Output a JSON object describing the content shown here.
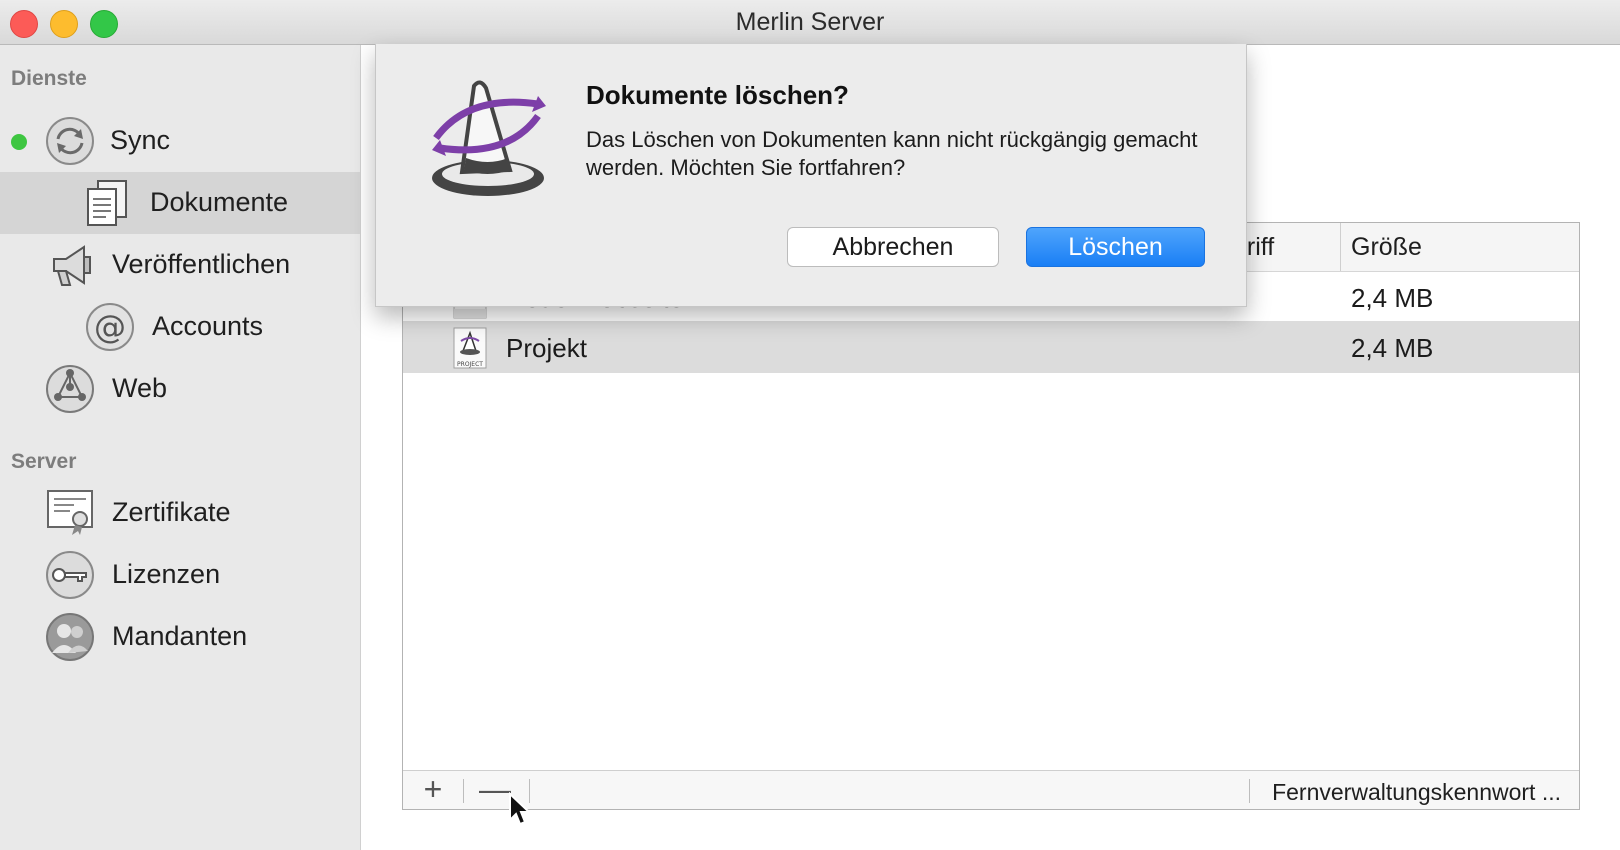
{
  "window": {
    "title": "Merlin Server"
  },
  "sidebar": {
    "sections": [
      {
        "label": "Dienste"
      },
      {
        "label": "Server"
      }
    ],
    "items": [
      {
        "label": "Sync",
        "icon": "sync-icon",
        "status": "online",
        "status_color": "#3ec641"
      },
      {
        "label": "Dokumente",
        "icon": "documents-icon",
        "selected": true
      },
      {
        "label": "Veröffentlichen",
        "icon": "megaphone-icon"
      },
      {
        "label": "Accounts",
        "icon": "at-sign-icon"
      },
      {
        "label": "Web",
        "icon": "network-globe-icon"
      },
      {
        "label": "Zertifikate",
        "icon": "certificate-icon"
      },
      {
        "label": "Lizenzen",
        "icon": "key-icon"
      },
      {
        "label": "Mandanten",
        "icon": "users-icon"
      }
    ]
  },
  "table": {
    "columns": [
      {
        "label": "griff"
      },
      {
        "label": "Größe"
      }
    ],
    "rows": [
      {
        "name": "Neue Webseite",
        "size": "2,4 MB",
        "icon": "merlin-project-file-icon",
        "icon_label": "PROJECT"
      },
      {
        "name": "Projekt",
        "size": "2,4 MB",
        "icon": "merlin-project-file-icon",
        "icon_label": "PROJECT",
        "selected": true
      }
    ],
    "footer": {
      "add_label": "+",
      "remove_label": "—",
      "password_label": "Fernverwaltungskennwort ..."
    }
  },
  "dialog": {
    "title": "Dokumente löschen?",
    "message": "Das Löschen von Dokumenten kann nicht rückgängig gemacht werden. Möchten Sie fortfahren?",
    "cancel_label": "Abbrechen",
    "confirm_label": "Löschen",
    "icon": "merlin-wizard-hat-icon",
    "accent_color": "#1a7ff5"
  }
}
